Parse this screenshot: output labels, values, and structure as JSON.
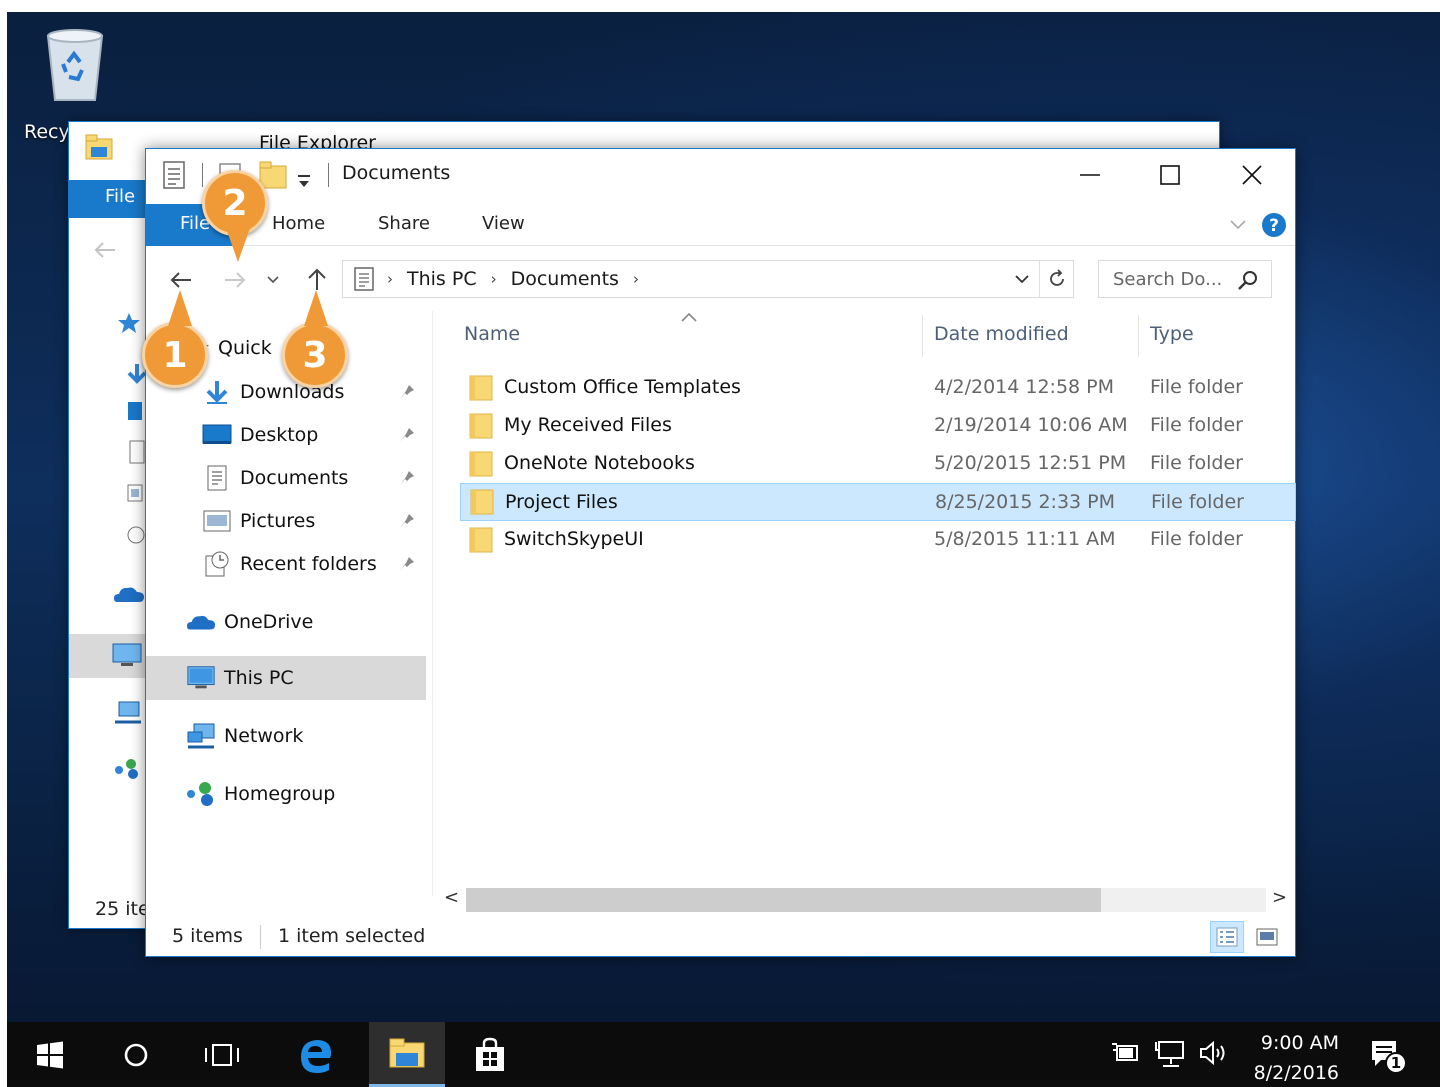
{
  "desktop": {
    "recycle_label": "Recy"
  },
  "back_window": {
    "title": "File Explorer",
    "file_tab": "File",
    "status": "25 ite"
  },
  "window": {
    "title": "Documents",
    "controls": {
      "minimize": "—",
      "maximize": "☐",
      "close": "✕"
    },
    "tabs": {
      "file": "File",
      "home": "Home",
      "share": "Share",
      "view": "View"
    },
    "address": {
      "crumbs": [
        "This PC",
        "Documents"
      ]
    },
    "search_placeholder": "Search Do...",
    "nav": {
      "quick_access": "Quick",
      "items": [
        {
          "label": "Downloads",
          "icon": "downloads-icon",
          "pinned": true
        },
        {
          "label": "Desktop",
          "icon": "desktop-icon",
          "pinned": true
        },
        {
          "label": "Documents",
          "icon": "documents-icon",
          "pinned": true
        },
        {
          "label": "Pictures",
          "icon": "pictures-icon",
          "pinned": true
        },
        {
          "label": "Recent folders",
          "icon": "recent-folders-icon",
          "pinned": true
        }
      ],
      "onedrive": "OneDrive",
      "this_pc": "This PC",
      "network": "Network",
      "homegroup": "Homegroup"
    },
    "columns": {
      "name": "Name",
      "date": "Date modified",
      "type": "Type"
    },
    "files": [
      {
        "name": "Custom Office Templates",
        "date": "4/2/2014 12:58 PM",
        "type": "File folder",
        "selected": false
      },
      {
        "name": "My Received Files",
        "date": "2/19/2014 10:06 AM",
        "type": "File folder",
        "selected": false
      },
      {
        "name": "OneNote Notebooks",
        "date": "5/20/2015 12:51 PM",
        "type": "File folder",
        "selected": false
      },
      {
        "name": "Project Files",
        "date": "8/25/2015 2:33 PM",
        "type": "File folder",
        "selected": true
      },
      {
        "name": "SwitchSkypeUI",
        "date": "5/8/2015 11:11 AM",
        "type": "File folder",
        "selected": false
      }
    ],
    "status": {
      "count": "5 items",
      "selected": "1 item selected"
    }
  },
  "callouts": [
    "1",
    "2",
    "3"
  ],
  "taskbar": {
    "time": "9:00 AM",
    "date": "8/2/2016",
    "notification_count": "1"
  },
  "colors": {
    "accent": "#1979ca",
    "callout": "#f09a37",
    "selection": "#cce8ff",
    "folder": "#f8d775"
  }
}
